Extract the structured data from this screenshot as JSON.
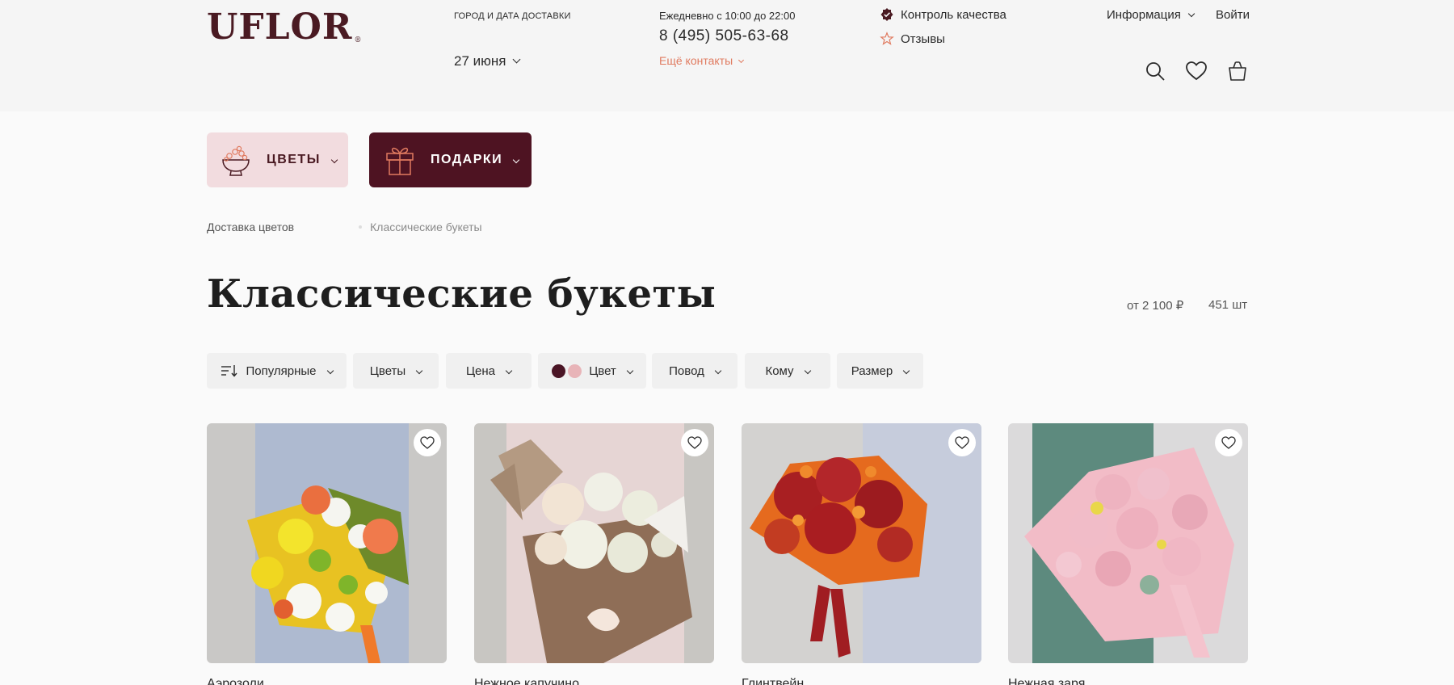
{
  "brand": {
    "name": "UFLOR",
    "reg_mark": "®"
  },
  "header": {
    "delivery_label": "ГОРОД И ДАТА ДОСТАВКИ",
    "delivery_date": "27 июня",
    "hours": "Ежедневно с 10:00 до 22:00",
    "phone": "8 (495) 505-63-68",
    "more_contacts": "Ещё контакты",
    "quality_control": "Контроль качества",
    "reviews": "Отзывы",
    "info": "Информация",
    "login": "Войти",
    "icons": [
      "search-icon",
      "heart-icon",
      "bag-icon"
    ]
  },
  "categories": [
    {
      "label": "ЦВЕТЫ",
      "icon": "bouquet-bowl-icon"
    },
    {
      "label": "ПОДАРКИ",
      "icon": "gift-box-icon"
    }
  ],
  "breadcrumbs": [
    {
      "label": "Доставка цветов"
    },
    {
      "label": "Классические букеты"
    }
  ],
  "page": {
    "title": "Классические букеты",
    "price_from": "от 2 100 ₽",
    "count": "451 шт"
  },
  "filters": [
    {
      "label": "Популярные",
      "icon": "sort-icon"
    },
    {
      "label": "Цветы"
    },
    {
      "label": "Цена"
    },
    {
      "label": "Цвет",
      "swatches": [
        "#4a1525",
        "#e8b4b8"
      ]
    },
    {
      "label": "Повод"
    },
    {
      "label": "Кому"
    },
    {
      "label": "Размер"
    }
  ],
  "products": [
    {
      "name": "Аэрозоли"
    },
    {
      "name": "Нежное капучино"
    },
    {
      "name": "Глинтвейн"
    },
    {
      "name": "Нежная заря"
    }
  ],
  "colors": {
    "brand": "#4a1a22",
    "accent": "#e07a5f",
    "flowers_bg": "#f2dcdf",
    "gifts_bg": "#4e1322"
  }
}
